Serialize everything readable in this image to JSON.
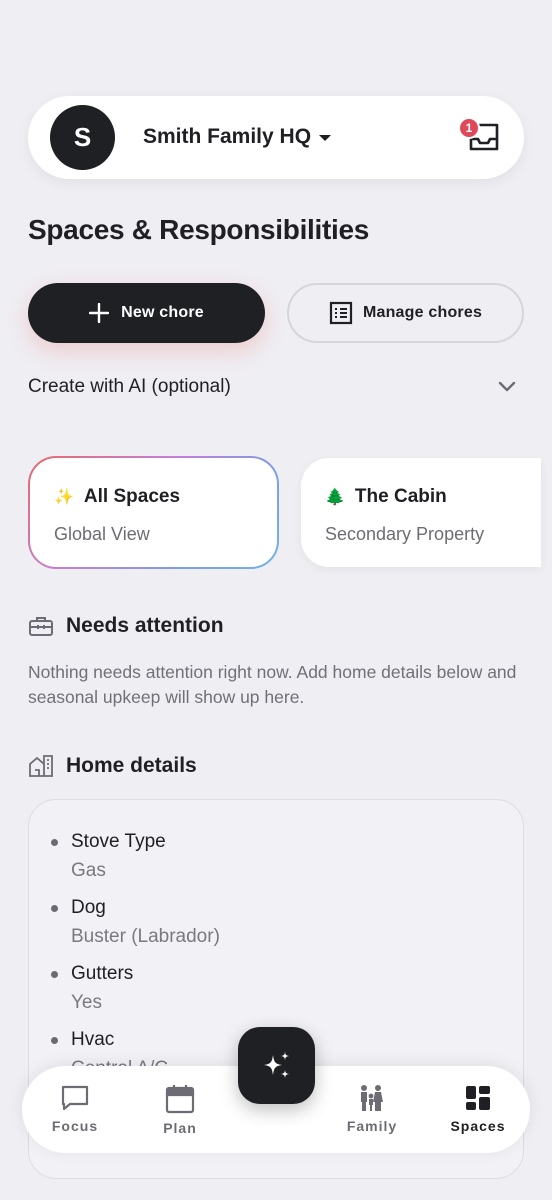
{
  "header": {
    "avatar_initial": "S",
    "family_name": "Smith Family HQ",
    "inbox_badge": "1"
  },
  "page_title": "Spaces & Responsibilities",
  "actions": {
    "new_chore": "New chore",
    "manage_chores": "Manage chores"
  },
  "ai_create": {
    "label": "Create with AI (optional)"
  },
  "spaces": [
    {
      "icon": "✨",
      "title": "All Spaces",
      "subtitle": "Global View"
    },
    {
      "icon": "🌲",
      "title": "The Cabin",
      "subtitle": "Secondary Property"
    }
  ],
  "needs_attention": {
    "title": "Needs attention",
    "text": "Nothing needs attention right now. Add home details below and seasonal upkeep will show up here."
  },
  "home_details": {
    "title": "Home details",
    "items": [
      {
        "key": "Stove Type",
        "value": "Gas"
      },
      {
        "key": "Dog",
        "value": "Buster (Labrador)"
      },
      {
        "key": "Gutters",
        "value": "Yes"
      },
      {
        "key": "Hvac",
        "value": "Central A/C"
      }
    ]
  },
  "nav": {
    "items": [
      {
        "label": "Focus",
        "icon": "chat-bubble-icon"
      },
      {
        "label": "Plan",
        "icon": "calendar-icon"
      },
      {
        "label": "Family",
        "icon": "family-icon"
      },
      {
        "label": "Spaces",
        "icon": "spaces-grid-icon"
      }
    ],
    "active": "Spaces"
  }
}
